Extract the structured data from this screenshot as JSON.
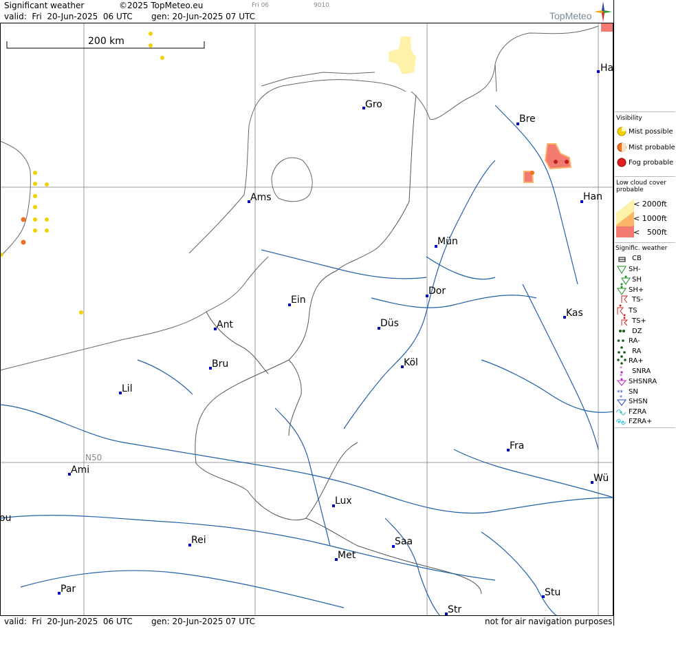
{
  "header": {
    "title": "Significant weather",
    "copyright": "©2025 TopMeteo.eu",
    "slot": "Fri 06",
    "code": "9010",
    "valid": "valid:  Fri  20-Jun-2025  06 UTC",
    "gen": "gen: 20-Jun-2025 07 UTC",
    "brand": "TopMeteo"
  },
  "footer": {
    "valid": "valid:  Fri  20-Jun-2025  06 UTC",
    "gen": "gen: 20-Jun-2025 07 UTC",
    "disclaimer": "not for air navigation purposes"
  },
  "map": {
    "scale_label": "200 km",
    "lat_label": "N50",
    "cities": [
      {
        "label": "Gro"
      },
      {
        "label": "Bre"
      },
      {
        "label": "Ha"
      },
      {
        "label": "Ams"
      },
      {
        "label": "Han"
      },
      {
        "label": "Mün"
      },
      {
        "label": "Dor"
      },
      {
        "label": "Ein"
      },
      {
        "label": "Ant"
      },
      {
        "label": "Düs"
      },
      {
        "label": "Kas"
      },
      {
        "label": "Bru"
      },
      {
        "label": "Köl"
      },
      {
        "label": "Lil"
      },
      {
        "label": "Fra"
      },
      {
        "label": "Ami"
      },
      {
        "label": "Wü"
      },
      {
        "label": "Lux"
      },
      {
        "label": "ou"
      },
      {
        "label": "Rei"
      },
      {
        "label": "Saa"
      },
      {
        "label": "Met"
      },
      {
        "label": "Par"
      },
      {
        "label": "Stu"
      },
      {
        "label": "Str"
      }
    ]
  },
  "legend": {
    "visibility": {
      "title": "Visibility",
      "items": [
        {
          "label": "Mist possible",
          "color": "#f5d000",
          "icon": "mist-possible-icon"
        },
        {
          "label": "Mist probable",
          "color": "#f07020",
          "icon": "mist-probable-icon"
        },
        {
          "label": "Fog probable",
          "color": "#e02020",
          "icon": "fog-probable-icon"
        }
      ]
    },
    "lowcloud": {
      "title": "Low cloud cover probable",
      "items": [
        {
          "label": "< 2000ft",
          "color": "#fdf2a8"
        },
        {
          "label": "< 1000ft",
          "color": "#fbb56a"
        },
        {
          "label": "<   500ft",
          "color": "#f27a70"
        }
      ]
    },
    "sigwx": {
      "title": "Signific. weather",
      "items": [
        {
          "label": "CB",
          "icon": "cb-icon"
        },
        {
          "label": "SH-",
          "icon": "shower-light-icon"
        },
        {
          "label": "SH",
          "icon": "shower-icon"
        },
        {
          "label": "SH+",
          "icon": "shower-heavy-icon"
        },
        {
          "label": "TS-",
          "icon": "thunderstorm-light-icon"
        },
        {
          "label": "TS",
          "icon": "thunderstorm-icon"
        },
        {
          "label": "TS+",
          "icon": "thunderstorm-heavy-icon"
        },
        {
          "label": "DZ",
          "icon": "drizzle-icon"
        },
        {
          "label": "RA-",
          "icon": "rain-light-icon"
        },
        {
          "label": "RA",
          "icon": "rain-icon"
        },
        {
          "label": "RA+",
          "icon": "rain-heavy-icon"
        },
        {
          "label": "SNRA",
          "icon": "snow-rain-icon"
        },
        {
          "label": "SHSNRA",
          "icon": "snow-rain-shower-icon"
        },
        {
          "label": "SN",
          "icon": "snow-icon"
        },
        {
          "label": "SHSN",
          "icon": "snow-shower-icon"
        },
        {
          "label": "FZRA",
          "icon": "freezing-rain-icon"
        },
        {
          "label": "FZRA+",
          "icon": "freezing-rain-heavy-icon"
        }
      ]
    }
  }
}
